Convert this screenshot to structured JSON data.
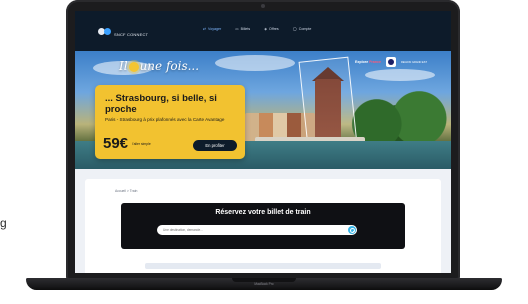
{
  "stray_char": "g",
  "site": {
    "logo_text": "SNCF CONNECT",
    "nav": [
      {
        "icon": "train-icon",
        "glyph": "⇄",
        "label": "Voyager"
      },
      {
        "icon": "ticket-icon",
        "glyph": "▭",
        "label": "Billets"
      },
      {
        "icon": "offers-icon",
        "glyph": "◈",
        "label": "Offres"
      },
      {
        "icon": "account-icon",
        "glyph": "◯",
        "label": "Compte"
      }
    ],
    "hero": {
      "brand_title_left": "Il",
      "brand_title_right": "une fois...",
      "explore_prefix": "Explore",
      "explore_highlight": "France",
      "partner_text": "REGION GRAND EST"
    },
    "promo": {
      "headline": "... Strasbourg, si belle, si proche",
      "subtitle": "Paris - Strasbourg à prix plafonnés avec la Carte Avantage",
      "price": "59€",
      "price_note": "l'aller simple",
      "cta": "En profiter"
    },
    "breadcrumb": "Accueil  >  Train",
    "booking": {
      "title": "Réservez votre billet de train",
      "search_placeholder": "Une destination, demande..."
    }
  },
  "device": {
    "model_label": "MacBook Pro"
  },
  "colors": {
    "nav_bg": "#0d1b2a",
    "promo_bg": "#f2c230",
    "booking_bg": "#0f1014",
    "search_button": "#38b6e8",
    "accent_link": "#7fb7ff"
  }
}
